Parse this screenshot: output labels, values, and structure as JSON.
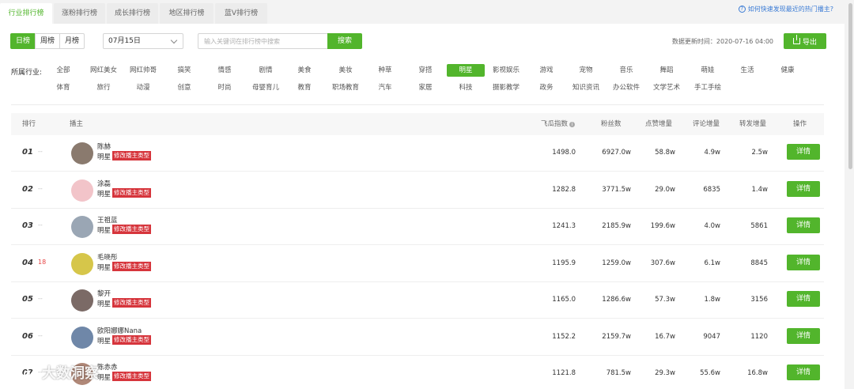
{
  "tabs": [
    {
      "label": "行业排行榜",
      "active": true
    },
    {
      "label": "涨粉排行榜",
      "active": false
    },
    {
      "label": "成长排行榜",
      "active": false
    },
    {
      "label": "地区排行榜",
      "active": false
    },
    {
      "label": "蓝V排行榜",
      "active": false
    }
  ],
  "help_link": "如何快速发现最近的热门播主?",
  "period_buttons": [
    {
      "label": "日榜",
      "active": true
    },
    {
      "label": "周榜",
      "active": false
    },
    {
      "label": "月榜",
      "active": false
    }
  ],
  "date_select": {
    "value": "07月15日"
  },
  "search": {
    "placeholder": "输入关键词在排行榜中搜索",
    "button_label": "搜索"
  },
  "update_time": "数据更新时间：2020-07-16 04:00",
  "export_label": "导出",
  "industry_label": "所属行业:",
  "industries_row1": [
    "全部",
    "网红美女",
    "网红帅哥",
    "搞笑",
    "情感",
    "剧情",
    "美食",
    "美妆",
    "种草",
    "穿搭",
    "明星",
    "影视娱乐",
    "游戏",
    "宠物",
    "音乐",
    "舞蹈",
    "萌娃",
    "生活",
    "健康"
  ],
  "industries_row2": [
    "体育",
    "旅行",
    "动漫",
    "创意",
    "时尚",
    "母婴育儿",
    "教育",
    "职场教育",
    "汽车",
    "家居",
    "科技",
    "摄影教学",
    "政务",
    "知识资讯",
    "办公软件",
    "文学艺术",
    "手工手绘"
  ],
  "active_industry": "明星",
  "table": {
    "headers": {
      "rank": "排行",
      "creator": "播主",
      "index": "飞瓜指数",
      "fans": "粉丝数",
      "likes": "点赞增量",
      "comments": "评论增量",
      "shares": "转发增量",
      "action": "操作"
    },
    "modify_tag": "修改播主类型",
    "detail_label": "详情",
    "rows": [
      {
        "rank": "01",
        "change": "--",
        "name": "陈赫",
        "type": "明星",
        "index": "1498.0",
        "fans": "6927.0w",
        "likes": "58.8w",
        "comments": "4.9w",
        "shares": "2.5w",
        "avatar_color": "#8a7a6e"
      },
      {
        "rank": "02",
        "change": "--",
        "name": "涂磊",
        "type": "明星",
        "index": "1282.8",
        "fans": "3771.5w",
        "likes": "29.0w",
        "comments": "6835",
        "shares": "1.4w",
        "avatar_color": "#f2c4c9"
      },
      {
        "rank": "03",
        "change": "--",
        "name": "王祖蓝",
        "type": "明星",
        "index": "1241.3",
        "fans": "2185.9w",
        "likes": "199.6w",
        "comments": "4.0w",
        "shares": "5861",
        "avatar_color": "#9aa6b4"
      },
      {
        "rank": "04",
        "change": "18",
        "name": "毛晓彤",
        "type": "明星",
        "index": "1195.9",
        "fans": "1259.0w",
        "likes": "307.6w",
        "comments": "6.1w",
        "shares": "8845",
        "avatar_color": "#d6c64a"
      },
      {
        "rank": "05",
        "change": "--",
        "name": "黎开",
        "type": "明星",
        "index": "1165.0",
        "fans": "1286.6w",
        "likes": "57.3w",
        "comments": "1.8w",
        "shares": "3156",
        "avatar_color": "#7b6a66"
      },
      {
        "rank": "06",
        "change": "--",
        "name": "欧阳娜娜Nana",
        "type": "明星",
        "index": "1152.2",
        "fans": "2159.7w",
        "likes": "16.7w",
        "comments": "9047",
        "shares": "1120",
        "avatar_color": "#6f87a8"
      },
      {
        "rank": "07",
        "change": "--",
        "name": "陈赤赤",
        "type": "明星",
        "index": "1121.8",
        "fans": "781.5w",
        "likes": "29.3w",
        "comments": "55.6w",
        "shares": "16.8w",
        "avatar_color": "#b08878"
      }
    ]
  },
  "watermark_text": "大数洞察"
}
